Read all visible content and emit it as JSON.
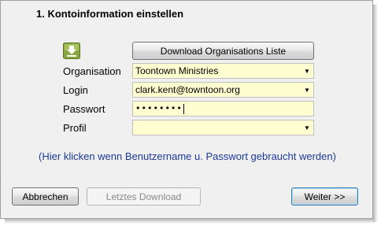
{
  "step_title": "1. Kontoinformation einstellen",
  "download_button": "Download Organisations Liste",
  "fields": {
    "organisation": {
      "label": "Organisation",
      "value": "Toontown Ministries"
    },
    "login": {
      "label": "Login",
      "value": "clark.kent@towntoon.org"
    },
    "password": {
      "label": "Passwort",
      "value": "••••••••"
    },
    "profile": {
      "label": "Profil",
      "value": ""
    }
  },
  "hint": "(Hier klicken wenn Benutzername u. Passwort gebraucht werden)",
  "buttons": {
    "cancel": "Abbrechen",
    "last_download": "Letztes Download",
    "next": "Weiter >>"
  },
  "colors": {
    "field_bg": "#fffed0",
    "hint_text": "#1b3a9a",
    "dialog_bg": "#f0f0f0"
  },
  "icons": {
    "download": "download-arrow-icon",
    "dropdown": "chevron-down-icon"
  }
}
